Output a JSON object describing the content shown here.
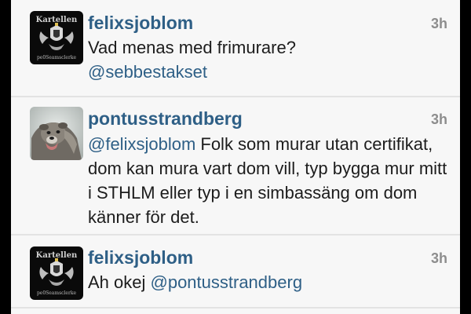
{
  "tweets": [
    {
      "username": "felixsjoblom",
      "time": "3h",
      "text_before": "Vad menas med frimurare?",
      "mention": "@sebbestakset",
      "text_after": "",
      "avatar": {
        "icon": "kartellen-crest-icon",
        "top_text": "Kartellen",
        "bottom_text": "pe0Seamsclerke"
      }
    },
    {
      "username": "pontusstrandberg",
      "time": "3h",
      "mention": "@felixsjoblom",
      "text_after": " Folk som murar utan certifikat, dom kan mura vart dom vill, typ bygga mur mitt i STHLM eller typ i en simbassäng om dom känner för det.",
      "avatar": {
        "icon": "dog-photo-icon"
      }
    },
    {
      "username": "felixsjoblom",
      "time": "3h",
      "text_before": "Ah okej ",
      "mention": "@pontusstrandberg",
      "text_after": "",
      "avatar": {
        "icon": "kartellen-crest-icon",
        "top_text": "Kartellen",
        "bottom_text": "pe0Seamsclerke"
      }
    }
  ],
  "colors": {
    "username": "#2e5f86",
    "mention": "#2e5f86",
    "text": "#1c1c1c",
    "time": "#8d8d8d",
    "background": "#f7f7f7",
    "divider": "#e3e3e3"
  }
}
